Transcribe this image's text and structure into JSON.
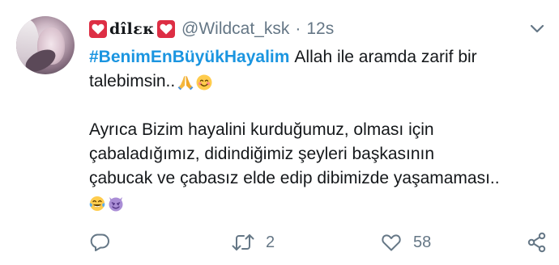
{
  "tweet": {
    "display_name": "dîlεκ",
    "handle": "@Wildcat_ksk",
    "separator": "·",
    "time": "12s",
    "hashtag": "#BenimEnBüyükHayalim",
    "line1_text": "Allah ile aramda zarif bir",
    "line2_text": "talebimsin..",
    "line3_text": "Ayrıca Bizim hayalini kurduğumuz, olması için",
    "line4_text": "çabaladığımız, didindiğimiz şeyleri başkasının",
    "line5_text": "çabucak ve çabasız elde edip dibimizde yaşamaması.."
  },
  "actions": {
    "reply_count": "",
    "retweet_count": "2",
    "like_count": "58"
  },
  "icons": {
    "name_decoration": "heart-icon",
    "more": "chevron-down-icon",
    "reply": "reply-icon",
    "retweet": "retweet-icon",
    "like": "like-icon",
    "share": "share-icon",
    "emoji_1": "folded-hands-emoji",
    "emoji_2": "smiling-face-emoji",
    "emoji_3": "tears-of-joy-emoji",
    "emoji_4": "smiling-devil-emoji"
  },
  "colors": {
    "hashtag": "#1b95e0",
    "secondary_text": "#657786",
    "heart": "#dd2e44",
    "text": "#14171a"
  }
}
